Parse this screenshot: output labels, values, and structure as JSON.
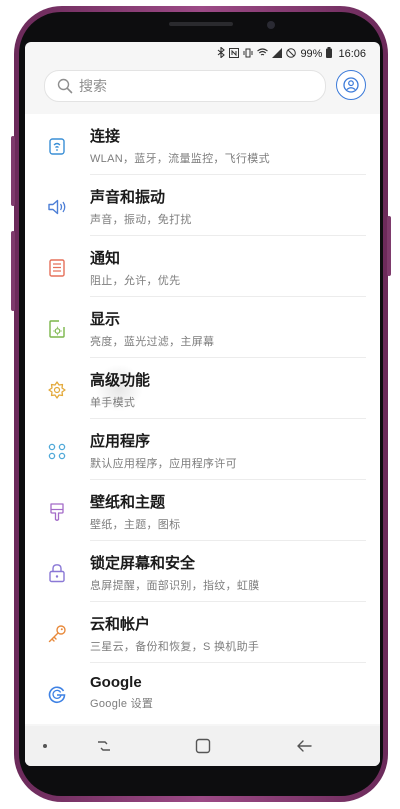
{
  "status": {
    "battery": "99%",
    "time": "16:06"
  },
  "search": {
    "placeholder": "搜索"
  },
  "settings": [
    {
      "title": "连接",
      "subtitle": "WLAN，蓝牙，流量监控，飞行模式",
      "icon": "connections-icon",
      "color": "#3a8fd6"
    },
    {
      "title": "声音和振动",
      "subtitle": "声音，振动，免打扰",
      "icon": "speaker-icon",
      "color": "#4d7fd6"
    },
    {
      "title": "通知",
      "subtitle": "阻止，允许，优先",
      "icon": "notification-icon",
      "color": "#e5705a"
    },
    {
      "title": "显示",
      "subtitle": "亮度，蓝光过滤，主屏幕",
      "icon": "display-icon",
      "color": "#7bb64a"
    },
    {
      "title": "高级功能",
      "subtitle": "单手模式",
      "icon": "advanced-features-icon",
      "color": "#e3a93b"
    },
    {
      "title": "应用程序",
      "subtitle": "默认应用程序，应用程序许可",
      "icon": "apps-icon",
      "color": "#4fa8d8"
    },
    {
      "title": "壁纸和主题",
      "subtitle": "壁纸，主题，图标",
      "icon": "brush-icon",
      "color": "#a36bc8"
    },
    {
      "title": "锁定屏幕和安全",
      "subtitle": "息屏提醒，面部识别，指纹，虹膜",
      "icon": "lock-icon",
      "color": "#8a78d6"
    },
    {
      "title": "云和帐户",
      "subtitle": "三星云，备份和恢复，S 换机助手",
      "icon": "key-icon",
      "color": "#e88a3c"
    },
    {
      "title": "Google",
      "subtitle": "Google 设置",
      "icon": "google-icon",
      "color": "#3f82e4"
    }
  ]
}
